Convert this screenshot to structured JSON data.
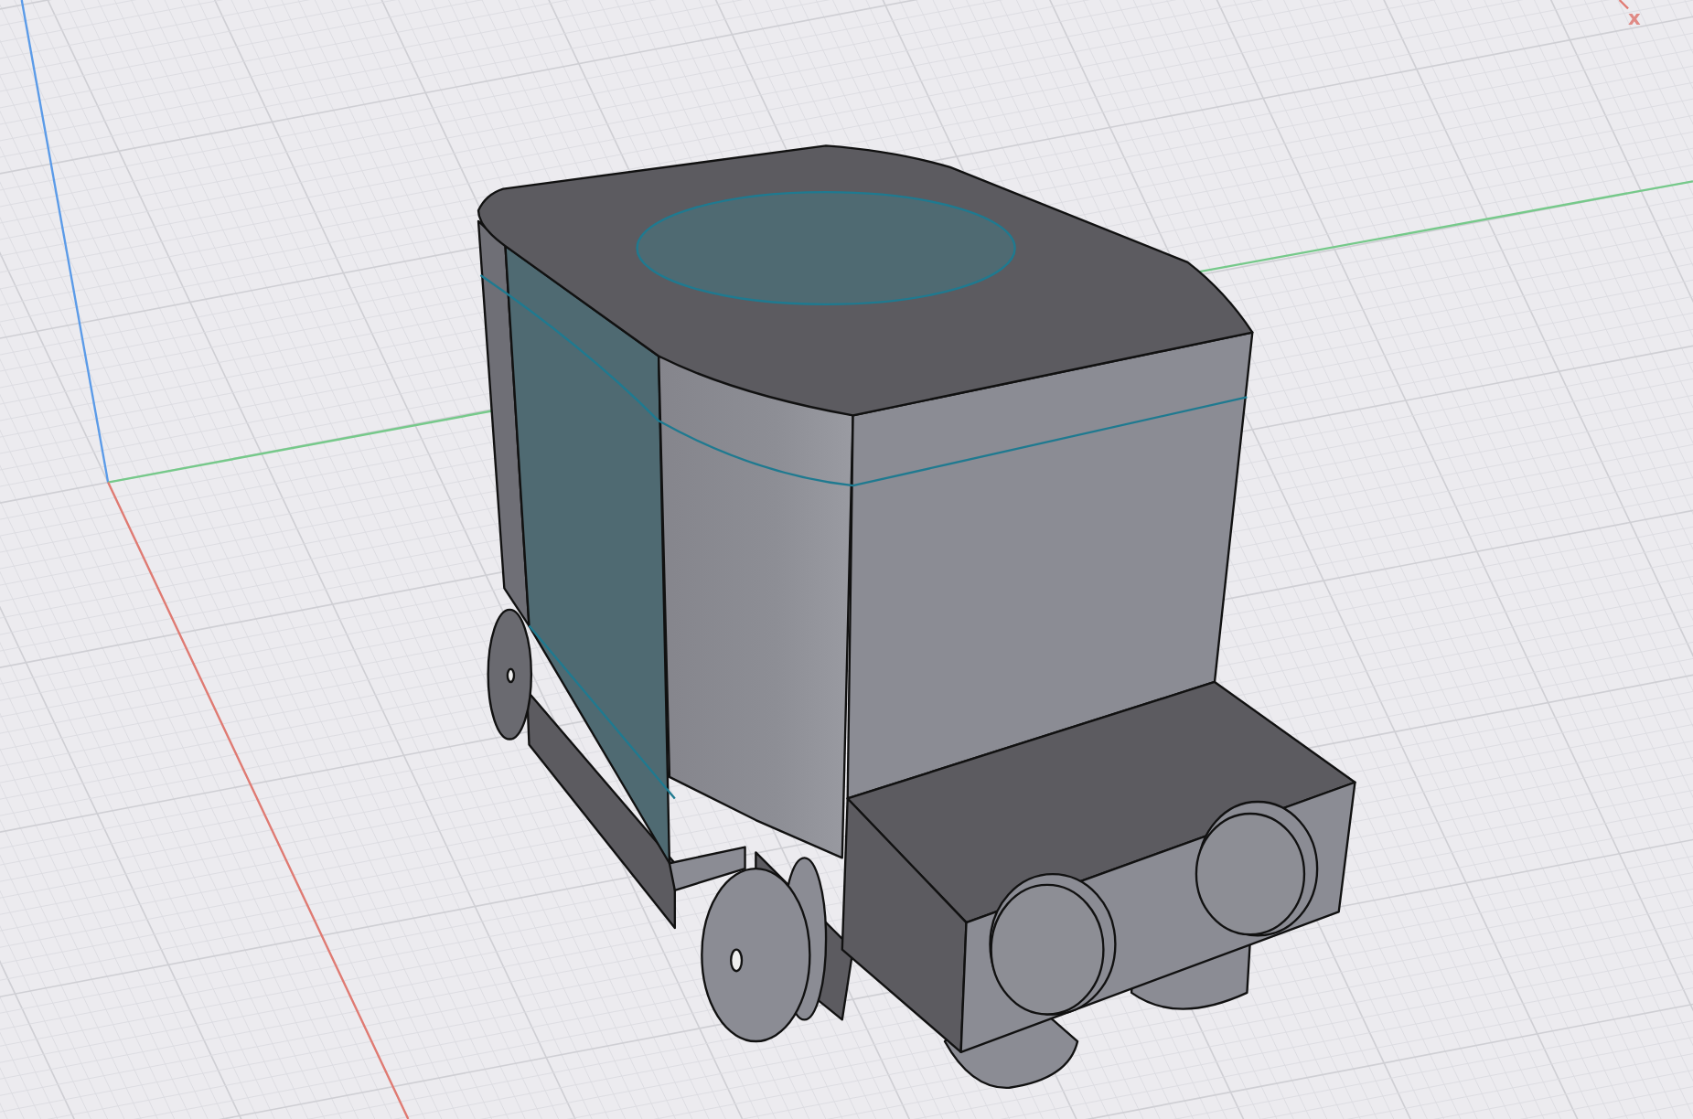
{
  "viewport": {
    "axis_label": "x"
  }
}
